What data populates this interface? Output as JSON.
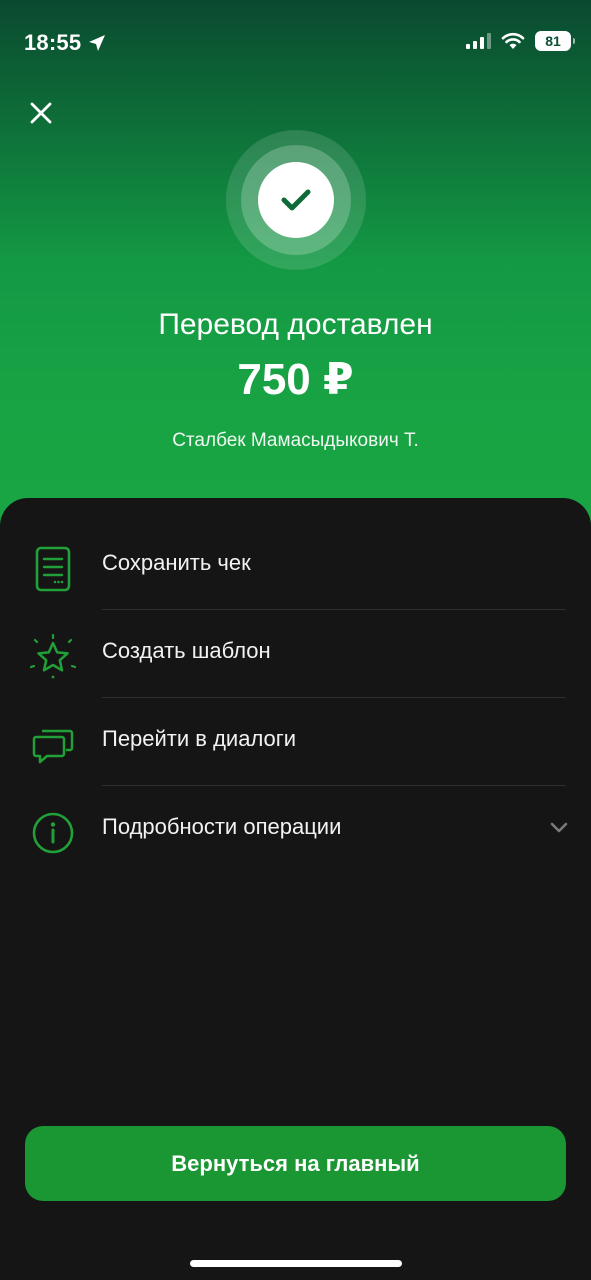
{
  "status_bar": {
    "time": "18:55",
    "battery": "81",
    "icons": [
      "location-arrow-icon",
      "signal-icon",
      "wifi-icon",
      "battery-icon"
    ]
  },
  "header": {
    "close_icon": "close-icon",
    "success_icon": "checkmark-icon",
    "title": "Перевод доставлен",
    "amount": "750 ₽",
    "recipient": "Сталбек Мамасыдыкович Т."
  },
  "actions": {
    "items": [
      {
        "label": "Сохранить чек",
        "icon": "receipt-icon"
      },
      {
        "label": "Создать шаблон",
        "icon": "star-icon"
      },
      {
        "label": "Перейти в диалоги",
        "icon": "chat-icon"
      },
      {
        "label": "Подробности операции",
        "icon": "info-icon"
      }
    ]
  },
  "footer": {
    "primary_button": "Вернуться на главный"
  },
  "colors": {
    "accent_green": "#21a038",
    "button_green": "#1a9632",
    "sheet_background": "#151515"
  }
}
